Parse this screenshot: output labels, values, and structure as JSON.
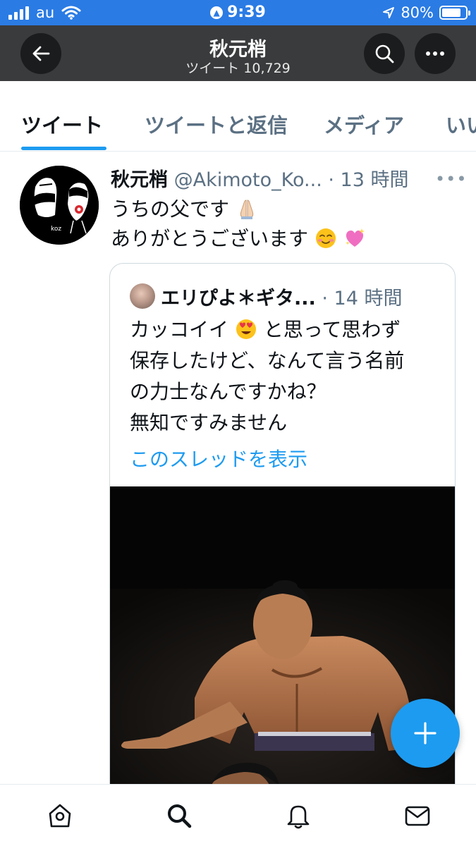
{
  "status_bar": {
    "carrier": "au",
    "time": "9:39",
    "battery": "80%",
    "battery_level": 0.8
  },
  "header": {
    "title": "秋元梢",
    "subtitle": "ツイート 10,729"
  },
  "tabs": [
    {
      "label": "ツイート",
      "active": true
    },
    {
      "label": "ツイートと返信",
      "active": false
    },
    {
      "label": "メディア",
      "active": false
    },
    {
      "label": "いい",
      "active": false
    }
  ],
  "tweet": {
    "name": "秋元梢",
    "handle": "@Akimoto_Ko...",
    "time": "· 13 時間",
    "line1": "うちの父です",
    "line2": "ありがとうございます",
    "avatar_text": "koz"
  },
  "quote": {
    "name": "エリぴよ＊ギタ...",
    "time": "· 14 時間",
    "line1_a": "カッコイイ",
    "line1_b": "と思って思わず",
    "line2": "保存したけど、なんて言う名前",
    "line3": "の力士なんですかね？",
    "line4": "無知ですみません",
    "thread_link": "このスレッドを表示"
  },
  "colors": {
    "accent": "#1d9bf0",
    "status_bar": "#2a7be4",
    "header_bg": "#3a3b3c"
  },
  "icons": [
    "back-arrow-icon",
    "search-icon",
    "more-icon",
    "compose-plus-icon",
    "home-icon",
    "explore-search-icon",
    "notifications-bell-icon",
    "messages-envelope-icon"
  ]
}
